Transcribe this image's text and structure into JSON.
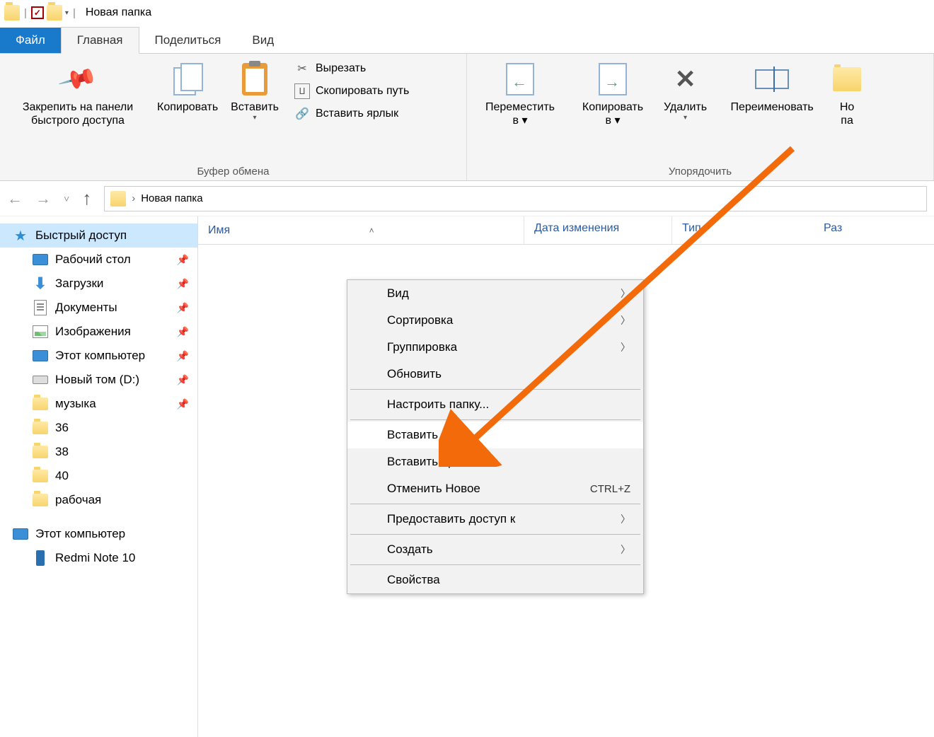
{
  "titlebar": {
    "title": "Новая папка"
  },
  "tabs": {
    "file": "Файл",
    "home": "Главная",
    "share": "Поделиться",
    "view": "Вид"
  },
  "ribbon": {
    "clipboard": {
      "pin": "Закрепить на панели\nбыстрого доступа",
      "copy": "Копировать",
      "paste": "Вставить",
      "cut": "Вырезать",
      "copypath": "Скопировать путь",
      "pasteshortcut": "Вставить ярлык",
      "label": "Буфер обмена"
    },
    "organize": {
      "moveto": "Переместить\nв ▾",
      "copyto": "Копировать\nв ▾",
      "delete": "Удалить",
      "rename": "Переименовать",
      "label": "Упорядочить"
    },
    "new": {
      "folder": "Но\nпа"
    }
  },
  "address": {
    "crumb1": "Новая папка"
  },
  "columns": {
    "name": "Имя",
    "date": "Дата изменения",
    "type": "Тип",
    "size": "Раз"
  },
  "sidebar": {
    "quick": "Быстрый доступ",
    "desktop": "Рабочий стол",
    "downloads": "Загрузки",
    "documents": "Документы",
    "pictures": "Изображения",
    "thispc": "Этот компьютер",
    "newvol": "Новый том (D:)",
    "music": "музыка",
    "f36": "36",
    "f38": "38",
    "f40": "40",
    "work": "рабочая",
    "thispc2": "Этот компьютер",
    "redmi": "Redmi Note 10"
  },
  "context": {
    "view": "Вид",
    "sort": "Сортировка",
    "group": "Группировка",
    "refresh": "Обновить",
    "customize": "Настроить папку...",
    "paste": "Вставить",
    "pasteshortcut": "Вставить ярлык",
    "undo": "Отменить Новое",
    "undo_key": "CTRL+Z",
    "share": "Предоставить доступ к",
    "new": "Создать",
    "properties": "Свойства"
  }
}
